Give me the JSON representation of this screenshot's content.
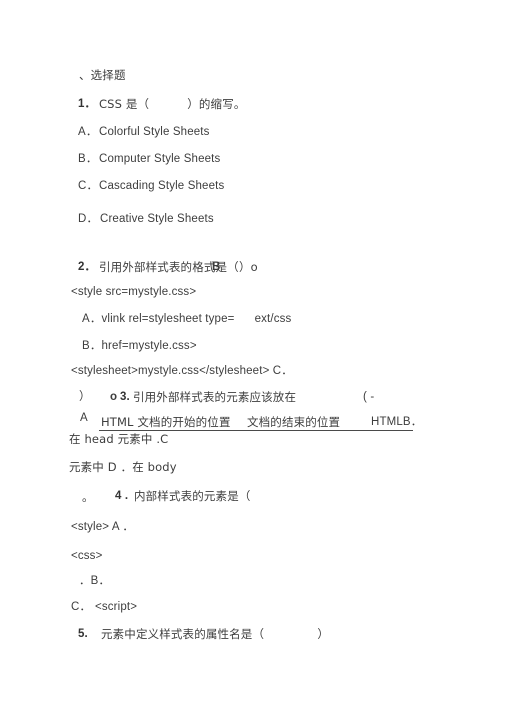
{
  "document": {
    "type": "scanned-quiz-worksheet",
    "language": "zh-CN",
    "background_color": "#ffffff",
    "text_color": "#3d3d3d",
    "section_heading": "、选择题"
  },
  "questions": [
    {
      "number": "1．",
      "stem": "CSS 是（          ）的缩写。",
      "options": [
        {
          "label": "A．",
          "text": "Colorful Style Sheets"
        },
        {
          "label": "B．",
          "text": "Computer Style Sheets"
        },
        {
          "label": "C．",
          "text": "Cascading Style Sheets"
        },
        {
          "label": "D．",
          "text": "Creative Style Sheets"
        }
      ]
    },
    {
      "number": "2．",
      "stem_prefix": "引用外部样式表的格式是（",
      "answer_mark": "B",
      "stem_suffix": "）o",
      "lines": [
        "<style src=mystyle.css>",
        "A．vlink rel=stylesheet type=      ext/css",
        "B．href=mystyle.css>",
        "<stylesheet>mystyle.css</stylesheet> C．"
      ]
    },
    {
      "number": "3.",
      "lead_fragment": "）",
      "stray_mark": "o",
      "stem": "引用外部样式表的元素应该放在",
      "trailing": "( -",
      "option_letter_a": "A",
      "blank_text_left": "HTML 文档的开始的位置",
      "blank_text_right": "文档的结束的位置",
      "after_blank": "HTMLB．",
      "line_b": "在 head 元素中 .C",
      "line_c": "元素中 D ．在 body"
    },
    {
      "number": "4 .",
      "lead_punct": "。",
      "stem": "内部样式表的元素是（",
      "options": [
        {
          "text": "<style> A ．"
        },
        {
          "text": "<css>"
        },
        {
          "text": "．B．"
        },
        {
          "label": "C．",
          "text": "<script>"
        }
      ]
    },
    {
      "number": "5.",
      "stem": "元素中定义样式表的属性名是（              ）"
    }
  ]
}
